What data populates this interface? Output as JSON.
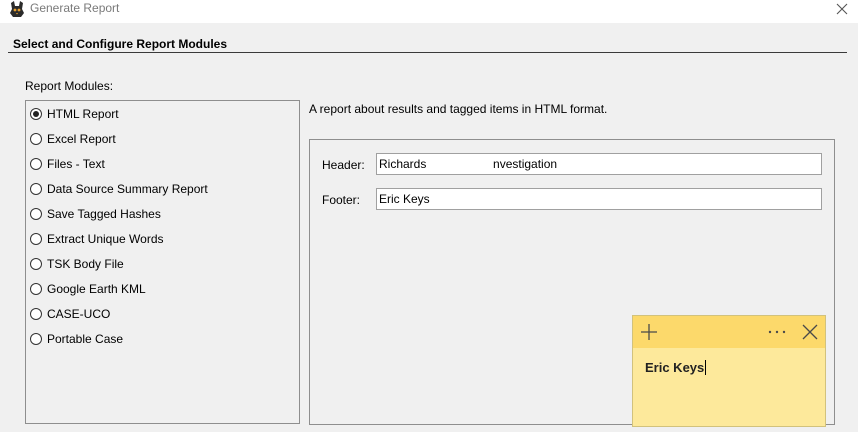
{
  "window": {
    "title": "Generate Report",
    "icon": "autopsy-dog-icon",
    "close_icon": "close-icon"
  },
  "section": {
    "heading": "Select and Configure Report Modules"
  },
  "modules": {
    "label": "Report Modules:",
    "selected_index": 0,
    "items": [
      {
        "label": "HTML Report"
      },
      {
        "label": "Excel Report"
      },
      {
        "label": "Files - Text"
      },
      {
        "label": "Data Source Summary Report"
      },
      {
        "label": "Save Tagged Hashes"
      },
      {
        "label": "Extract Unique Words"
      },
      {
        "label": "TSK Body File"
      },
      {
        "label": "Google Earth KML"
      },
      {
        "label": "CASE-UCO"
      },
      {
        "label": "Portable Case"
      }
    ]
  },
  "config": {
    "description": "A report about results and tagged items in HTML format.",
    "header_label": "Header:",
    "header_value": "Richards                    nvestigation",
    "footer_label": "Footer:",
    "footer_value": "Eric Keys"
  },
  "sticky_note": {
    "text": "Eric Keys",
    "add_icon": "plus-icon",
    "menu_icon": "more-icon",
    "close_icon": "close-icon",
    "background": "#fde99b",
    "header_color": "#fcd96b"
  }
}
